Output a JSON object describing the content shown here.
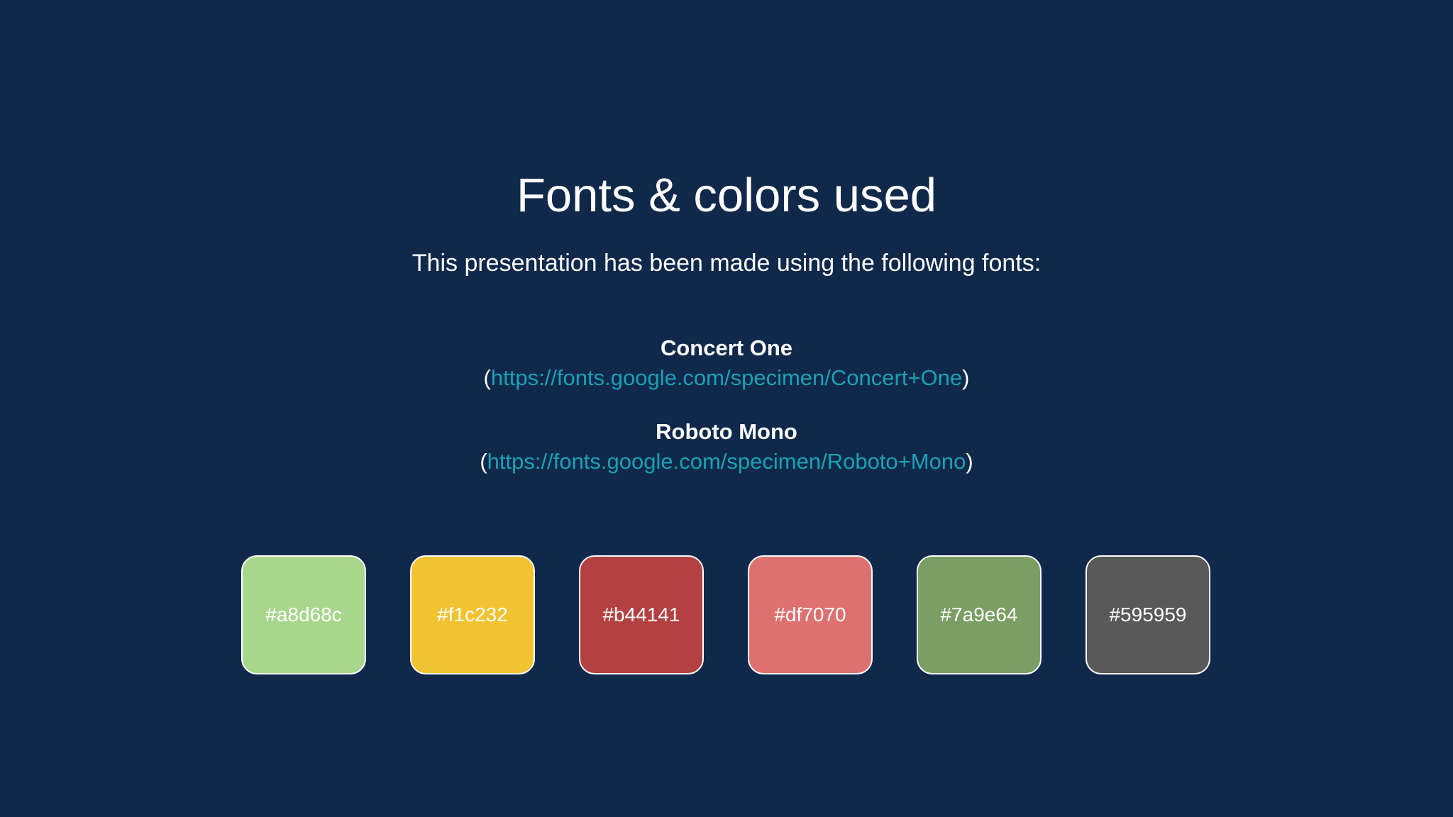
{
  "slide": {
    "title": "Fonts & colors used",
    "subtitle": "This presentation has been made using the following fonts:",
    "fonts": [
      {
        "name": "Concert One",
        "open_paren": "(",
        "url": "https://fonts.google.com/specimen/Concert+One",
        "close_paren": ")"
      },
      {
        "name": "Roboto Mono",
        "open_paren": "(",
        "url": "https://fonts.google.com/specimen/Roboto+Mono",
        "close_paren": ")"
      }
    ],
    "colors": [
      {
        "label": "#a8d68c",
        "hex": "#a8d68c"
      },
      {
        "label": "#f1c232",
        "hex": "#f1c232"
      },
      {
        "label": "#b44141",
        "hex": "#b44141"
      },
      {
        "label": "#df7070",
        "hex": "#df7070"
      },
      {
        "label": "#7a9e64",
        "hex": "#7a9e64"
      },
      {
        "label": "#595959",
        "hex": "#595959"
      }
    ],
    "theme": {
      "background": "#10294a",
      "link_color": "#1aa1b4",
      "text_color": "#ffffff"
    }
  }
}
